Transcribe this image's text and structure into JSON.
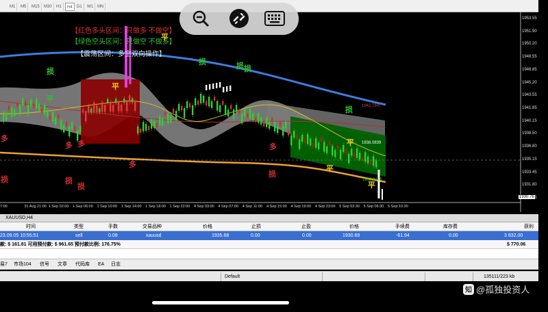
{
  "timeframes": [
    "M1",
    "M5",
    "M15",
    "M30",
    "H1",
    "H4",
    "D1",
    "W1",
    "MN"
  ],
  "active_timeframe": "H4",
  "annotations": {
    "bull_zone": "【红色多头区间：只做多 不做空】",
    "bear_zone": "【绿色空头区间：只做空 不做多】",
    "range_zone": "【震荡区间：多空双向操作】"
  },
  "marks": {
    "loss": "损",
    "long": "多",
    "flat": "平"
  },
  "price_axis": {
    "labels": [
      "1953.55",
      "1951.90",
      "1950.20",
      "1948.55",
      "1946.85",
      "1945.20",
      "1943.55",
      "1941.85",
      "1940.15",
      "1938.50",
      "1936.80",
      "1935.15",
      "1933.45",
      "1931.80",
      "1930.15"
    ],
    "current_price": "1930.76"
  },
  "chart_labels": {
    "upper_ma": "1942.7847",
    "mid_ma": "1938.0839",
    "low_ma": "1933.9426"
  },
  "time_axis": [
    "7:00",
    "31 Aug 21:00",
    "1 Sep 02:00",
    "1 Sep 06:00",
    "1 Sep 10:00",
    "1 Sep 14:00",
    "1 Sep 18:00",
    "1 Sep 22:00",
    "4 Sep 03:00",
    "4 Sep 07:00",
    "4 Sep 11:00",
    "4 Sep 15:00",
    "4 Sep 19:00",
    "4 Sep 23:00",
    "5 Sep 02:30",
    "5 Sep 06:30",
    "5 Sep 10:30"
  ],
  "chart_tab": "XAUUSD,H4",
  "table": {
    "headers": [
      "时间",
      "类型",
      "手数",
      "交易品种",
      "价格",
      "止损",
      "止盈",
      "价格",
      "手续费",
      "库存费",
      "获利"
    ],
    "row": [
      "23.09.05 10:55:51",
      "sell",
      "0.08",
      "xauusd",
      "1935.68",
      "0.00",
      "0.00",
      "1930.69",
      "-61.94",
      "0.00",
      "3 832.00"
    ]
  },
  "balance": {
    "text": "款: $ 161.81   可用预付款: $ 961.65   预付款比例: 176.75%",
    "total": "$ 770.06"
  },
  "terminal_tabs": [
    "易7",
    "市场104",
    "信号",
    "文章",
    "代码库",
    "EA",
    "日志"
  ],
  "status": {
    "profile": "Default",
    "traffic": "135111/223 kb"
  },
  "watermark": "@孤独投资人",
  "colors": {
    "bull_zone": "#8b0000",
    "bear_zone": "#006400",
    "upper_ma": "#3a7fe0",
    "low_ma": "#f0a030",
    "selected_row": "#3a6fd0"
  }
}
